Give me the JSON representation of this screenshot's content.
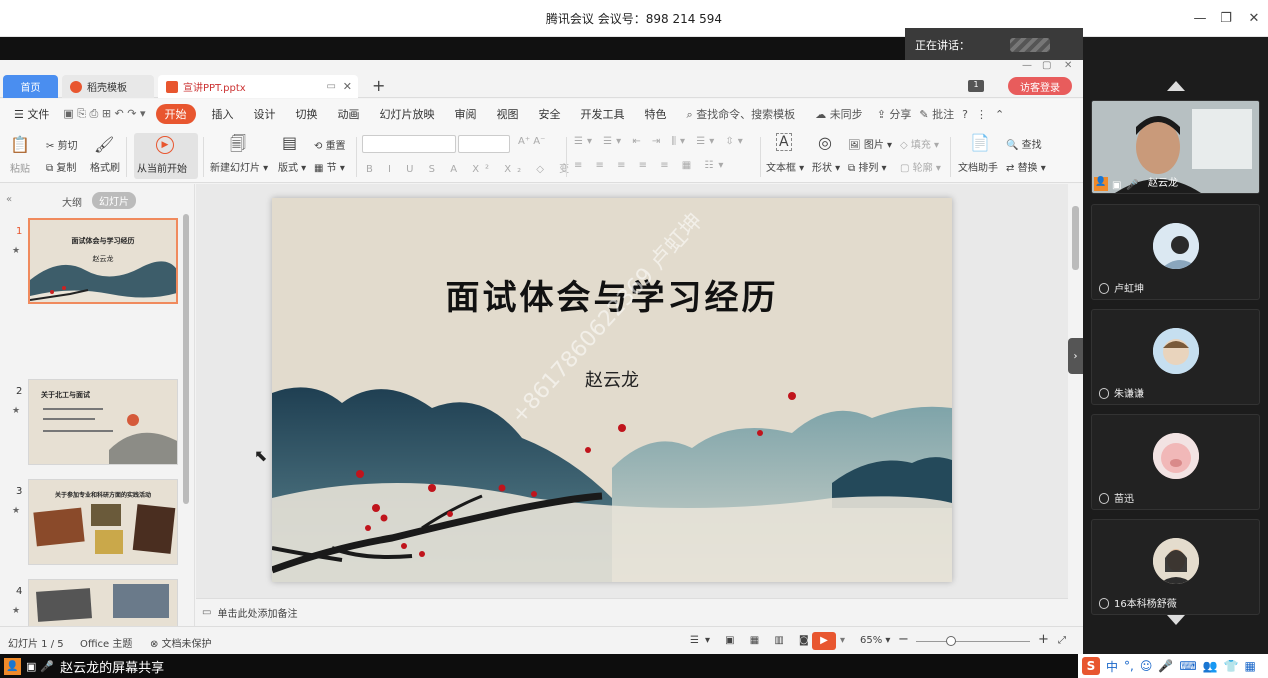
{
  "meeting": {
    "title": "腾讯会议 会议号：898 214 594",
    "speaking_label": "正在讲话：",
    "share_label": "赵云龙的屏幕共享"
  },
  "tabs": {
    "home": "首页",
    "template": "稻壳模板",
    "doc": "宣讲PPT.pptx",
    "login": "访客登录"
  },
  "menu": {
    "file": "文件",
    "start": "开始",
    "items": [
      "插入",
      "设计",
      "切换",
      "动画",
      "幻灯片放映",
      "审阅",
      "视图",
      "安全",
      "开发工具",
      "特色"
    ],
    "search": "查找命令、搜索模板",
    "sync": "未同步",
    "share": "分享",
    "comment": "批注"
  },
  "ribbon": {
    "paste": "粘贴",
    "cut": "剪切",
    "copy": "复制",
    "format_brush": "格式刷",
    "from_current": "从当前开始",
    "new_slide": "新建幻灯片",
    "layout": "版式",
    "reset": "重置",
    "section": "节",
    "textbox": "文本框",
    "shape": "形状",
    "picture": "图片",
    "arrange": "排列",
    "fill": "填充",
    "outline": "轮廓",
    "doc_assistant": "文档助手",
    "find": "查找",
    "replace": "替换"
  },
  "panel": {
    "outline_tab": "大纲",
    "slides_tab": "幻灯片",
    "add": "+"
  },
  "thumbnails": [
    {
      "num": "1",
      "title": "面试体会与学习经历",
      "sub": "赵云龙"
    },
    {
      "num": "2",
      "title": "关于北工与面试"
    },
    {
      "num": "3",
      "title": "关于参加专业和科研方面的实践活动"
    },
    {
      "num": "4",
      "title": ""
    }
  ],
  "slide": {
    "title": "面试体会与学习经历",
    "author": "赵云龙",
    "watermark": "+8617860622369 卢虹坤"
  },
  "notes": "单击此处添加备注",
  "status": {
    "slide_pos": "幻灯片 1 / 5",
    "theme": "Office 主题",
    "protect": "文档未保护",
    "zoom": "65%"
  },
  "participants": [
    {
      "name": "赵云龙"
    },
    {
      "name": "卢虹坤"
    },
    {
      "name": "朱谦谦"
    },
    {
      "name": "苗迅"
    },
    {
      "name": "16本科杨舒薇"
    }
  ],
  "ime": {
    "lang": "中"
  },
  "colors": {
    "accent": "#e8562f",
    "tab_blue": "#4a8ef0",
    "login_red": "#e85c5c",
    "slide_bg": "#e2dbcd"
  }
}
